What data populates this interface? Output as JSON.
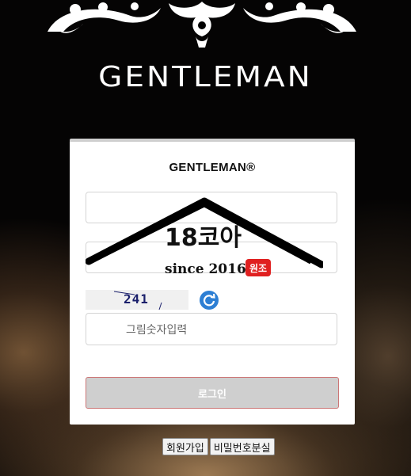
{
  "site": {
    "brand_title": "GENTLEMAN",
    "ornament_icon": "ornament-icon"
  },
  "login_card": {
    "title": "GENTLEMAN®",
    "id_placeholder": "",
    "password_placeholder": "",
    "captcha_code": "241",
    "captcha_placeholder": "그림숫자입력",
    "refresh_icon": "refresh-icon",
    "login_label": "로그인"
  },
  "watermark": {
    "main_text": "18코아",
    "since_text": "since 2016",
    "badge_text": "원조"
  },
  "footer": {
    "signup_label": "회원가입",
    "lost_password_label": "비밀번호분실"
  },
  "colors": {
    "refresh": "#2d7fd4",
    "badge": "#e02020",
    "login_button_bg": "#cfcfcf",
    "login_button_border": "#cc7777"
  }
}
